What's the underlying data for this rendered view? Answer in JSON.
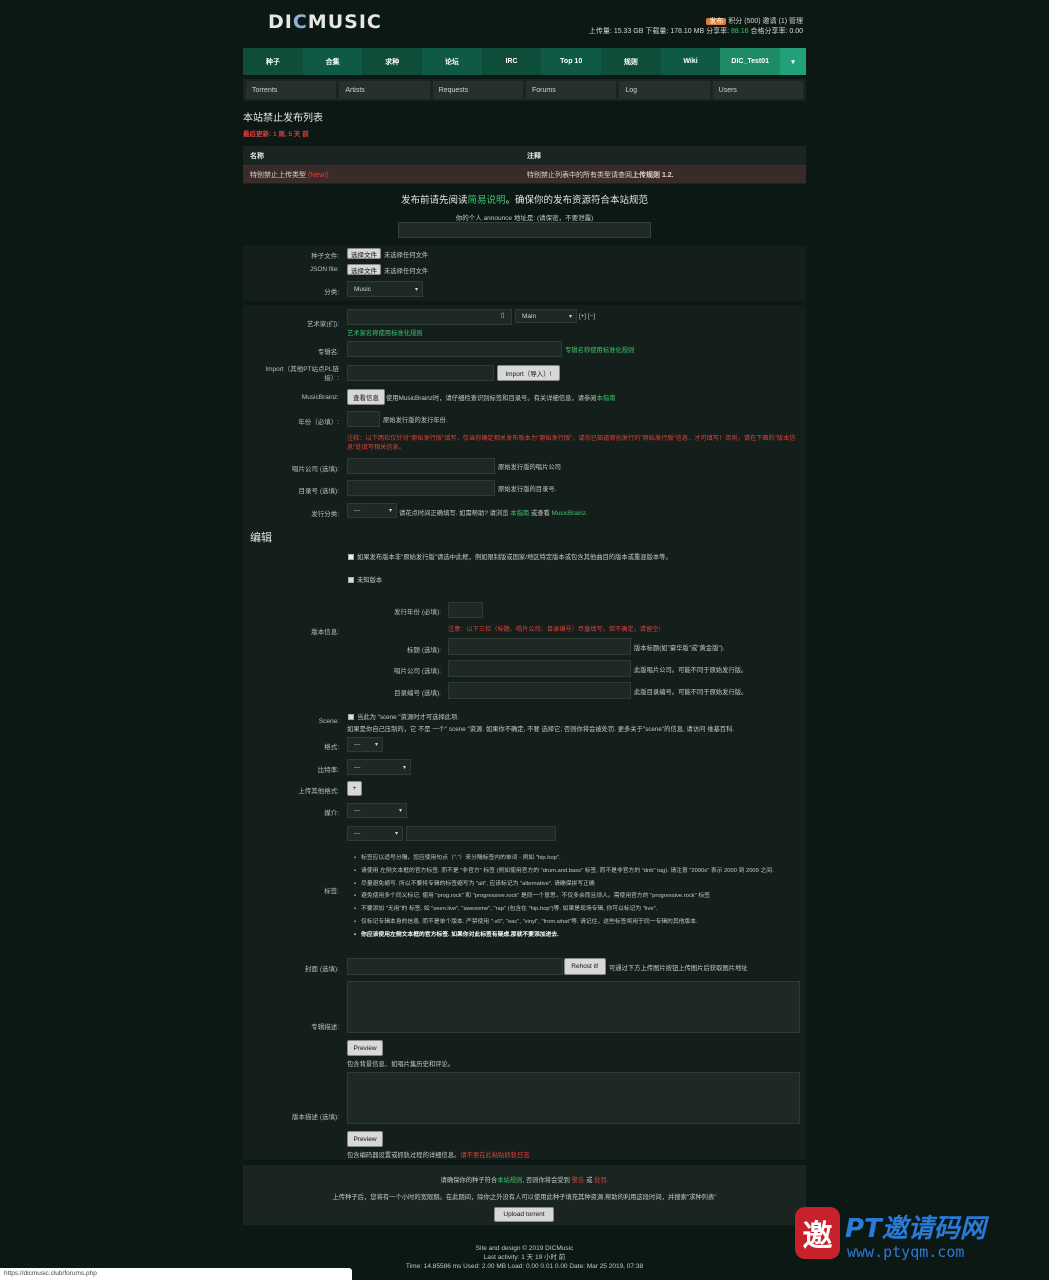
{
  "logo": "DICMUSIC",
  "user": {
    "badge": "发布",
    "points": "积分 (500)",
    "invites": "邀请 (1)",
    "admin": "管理",
    "upload_label": "上传量:",
    "upload": "15.33 GB",
    "download_label": "下载量:",
    "download": "178.10 MB",
    "ratio_label": "分享率:",
    "ratio": "88.16",
    "req_label": "合格分享率:",
    "req": "0.00"
  },
  "nav1": [
    "种子",
    "合集",
    "求种",
    "论坛",
    "IRC",
    "Top 10",
    "规则",
    "Wiki",
    "DIC_Test01"
  ],
  "nav2": [
    "Torrents",
    "Artists",
    "Requests",
    "Forums",
    "Log",
    "Users"
  ],
  "page_title": "本站禁止发布列表",
  "last_update": "最后更新: 1 周, 5 天 前",
  "rules_table": {
    "h1": "名称",
    "h2": "注释",
    "r1c1": "特别禁止上传类型",
    "r1new": "(New!)",
    "r1c2": "特别禁止列表中的所有类型请查阅",
    "r1c2b": "上传规则 1.2."
  },
  "notice": {
    "pre": "发布前请先阅读",
    "link": "简易说明",
    "post": "。确保你的发布资源符合本站规范"
  },
  "announce": "你的个人 announce 地址是: (请保密，不要泄露)",
  "form": {
    "torrent_file": "种子文件:",
    "choose": "选择文件",
    "nofile": "未选择任何文件",
    "json_file": "JSON file:",
    "category": "分类:",
    "category_val": "Music",
    "artist": "艺术家(们):",
    "artist_role": "Main",
    "artist_addrem": "[+] [−]",
    "artist_hint": "艺术家名称使用标准化规则",
    "album": "专辑名:",
    "album_hint": "专辑名称使用标准化规则",
    "import_label": "Import（其他PT站点PL链接）:",
    "import_btn": "Import（导入）!",
    "mb_label": "MusicBrainz:",
    "mb_btn": "查看信息",
    "mb_hint_a": "使用MusicBrainz时，请仔细检查识别标签和目录号。有关详细信息，请参阅",
    "mb_hint_link": "本指南",
    "year": "年份（必填）:",
    "year_hint": "原始发行版的发行年份.",
    "year_warn": "注释：以下两栏仅针对\"原始发行版\"填写，仅当你确定相关发布版本为\"原始发行版\"，或你已知道原创发行的\"原始发行版\"信息，才可填写！否则，请在下面的\"版本信息\"处填写相关信息。",
    "label": "唱片公司 (选填):",
    "label_hint": "原始发行版的唱片公司",
    "catno": "目录号 (选填):",
    "catno_hint": "原始发行版的目录号.",
    "reltype": "发行分类:",
    "reltype_val": "---",
    "reltype_hint_a": "请花点时间正确填写. 如需帮助? 请浏览",
    "reltype_link1": "本指南",
    "reltype_or": "或查看",
    "reltype_link2": "MusicBrainz.",
    "edit_section": "编辑",
    "orig_check": "如果发布版本非\"原始发行版\"请选中此框，例如限制版或国家/地区特定版本或包含其他曲目的版本或重混版本等。",
    "unknown_check": "未知版本",
    "edition_label": "版本信息:",
    "ed_year": "发行年份 (必填):",
    "ed_warn": "注意：以下三栏（标题、唱片公司、目录编号）尽量填写，但不确定，请留空!",
    "ed_title": "标题 (选填):",
    "ed_title_hint": "版本标题(如\"豪华版\"或\"黄金版\").",
    "ed_label": "唱片公司 (选填):",
    "ed_label_hint": "此版唱片公司。可能不同于原始发行版。",
    "ed_catno": "目录编号 (选填):",
    "ed_catno_hint": "此版目录编号。可能不同于原始发行版。",
    "scene": "Scene:",
    "scene_check": "当此为 \"scene \"资源时才可选择此项.",
    "scene_hint": "如果是你自己压制的，它 不是 一个\" scene \"资源. 如果你不确定, 不要 选择它; 否则你将会被处罚. 更多关于\"scene\"的信息, 请访问 维基百科.",
    "format": "格式:",
    "format_val": "---",
    "bitrate": "比特率:",
    "bitrate_val": "---",
    "other_fmt": "上传其他格式:",
    "plus": "+",
    "media": "媒介:",
    "media_val": "---",
    "tags_sel": "---",
    "tags_label": "标签:",
    "tags_rules": [
      "标签应以适号分隔，您应使用句点（\".\"）来分隔标签内的单词 - 例如 \"hip.hop\".",
      "请使用 左侧文本框的官方标签. 而不是 \"非官方\" 标签 (例如使用官方的 \"drum.and.bass\" 标签, 而不是非官方的 \"dnb\" tag). 请注意 \"2000s\" 表示 2000 到 2009 之间.",
      "尽量避免缩写. 所以不要将专辑的标签缩写为 \"alt\", 应该标记为 \"alternative\". 请确保拼写正确",
      "避免使用多个同义标记. 使用 \"prog.rock\" 和 \"progressive.rock\" 是同一个意思，不仅多余而且烦人。需使用官方的 \"progressive.rock\" 标签",
      "不要添加 \"无用\"的 标签, 如 \"seen.live\", \"awesome\", \"rap\" (包含在 \"hip.hop\")等. 如果是现场专辑, 你可以标记为 \"live\".",
      "仅标记专辑本身的信息, 而不是单个版本. 严禁使用 \".v0\", \"eac\", \"vinyl\", \"from.what\"等. 请记住，这些标签将用于同一专辑的其他版本.",
      "你应该使用左侧文本框的官方标签. 如果你对此标签有疑虑,那就不要添加进去."
    ],
    "cover": "封面 (选填):",
    "rehost": "Rehost it!",
    "cover_hint": "可通过下方上传图片按钮上传图片后获取图片地址",
    "desc": "专辑描述:",
    "preview": "Preview",
    "desc_hint": "包含背景信息、如唱片集历史和评论。",
    "ed_desc": "版本描述 (选填):",
    "ed_desc_hint_a": "包含编码器设置或抓轨过程的详细信息。",
    "ed_desc_hint_b": "请不要在此粘贴抓轨日志"
  },
  "submit": {
    "line1_a": "请确保你的种子符合",
    "line1_link": "本站规则",
    "line1_b": ", 否则你将会受到",
    "line1_c": "警告",
    "line1_d": "或",
    "line1_e": "处罚.",
    "line2": "上传种子后，您将有一个小时的宽限期。在此期间，除你之外没有人可以使用此种子填充其种资源,帮助的利用这段时间，并搜索\"求种列表\"",
    "button": "Upload torrent"
  },
  "footer": {
    "l1": "Site and design © 2019 DICMusic",
    "l2": "Last activity: 1 天 19 小时 前",
    "l3": "Time: 14.85586 ms Used: 2.00 MB Load: 0.00 0.01 0.00 Date: Mar 25 2019, 07:38"
  },
  "statusbar": "https://dicmusic.club/forums.php",
  "watermark": {
    "big": "PT邀请码网",
    "small": "www.ptyqm.com",
    "mark": "邀"
  }
}
